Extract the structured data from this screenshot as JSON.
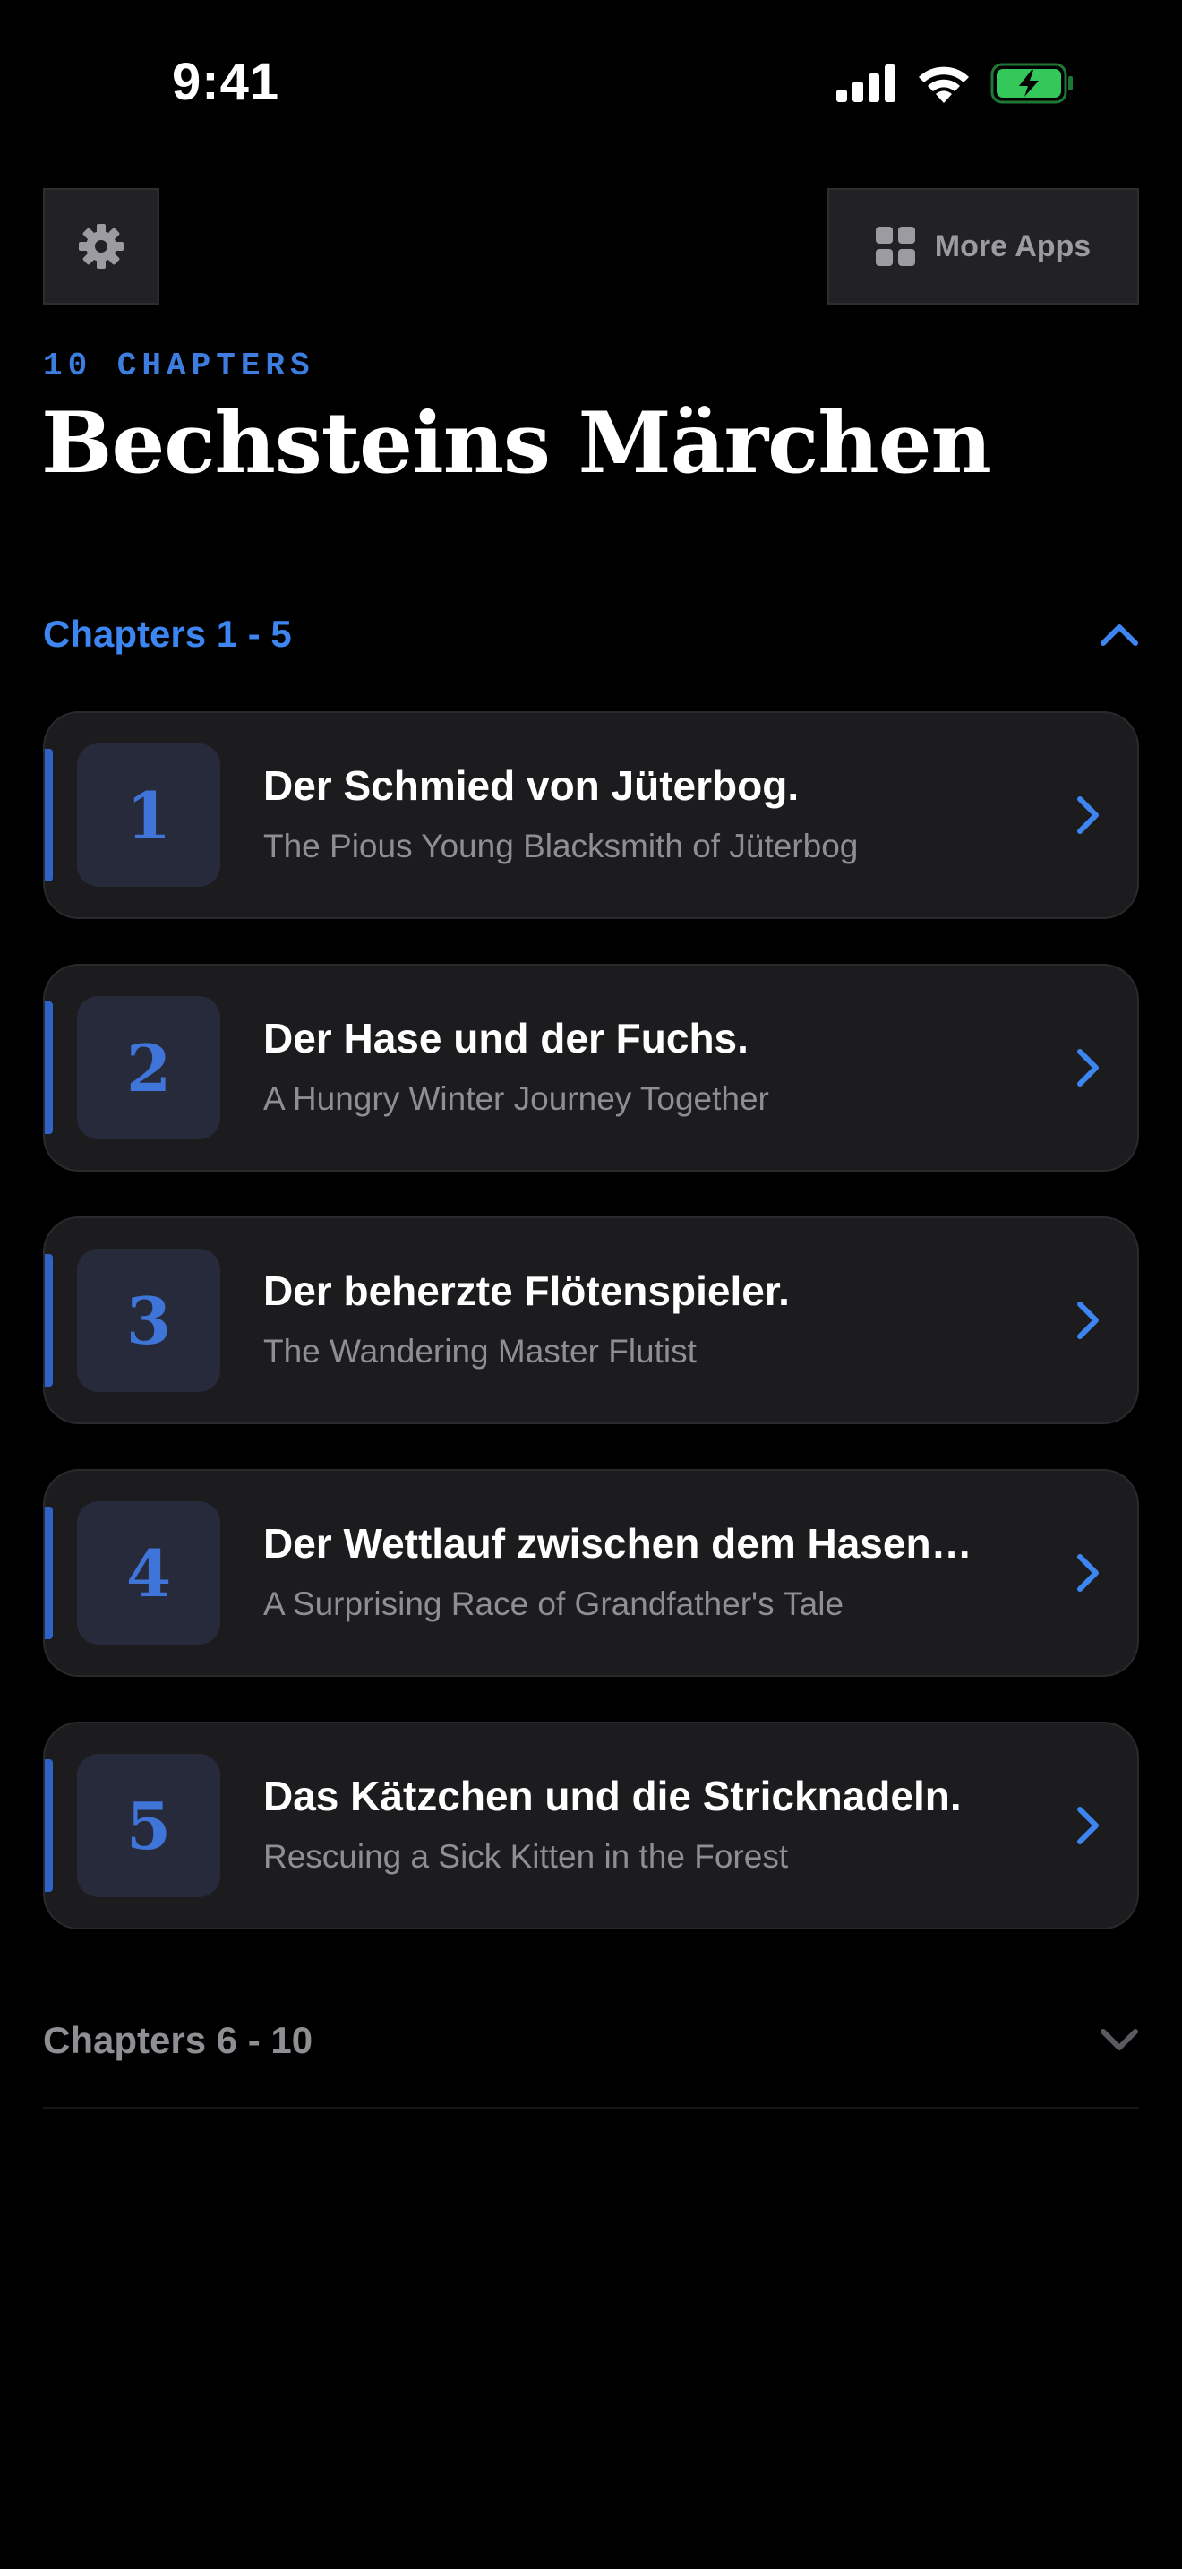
{
  "status_bar": {
    "time": "9:41"
  },
  "header": {
    "settings_icon": "gear-icon",
    "more_apps_label": "More Apps",
    "more_apps_icon": "grid-icon",
    "chapter_count": "10 CHAPTERS",
    "title": "Bechsteins Märchen"
  },
  "sections": [
    {
      "label": "Chapters 1 - 5",
      "expanded": true,
      "icon": "chevron-up-icon"
    },
    {
      "label": "Chapters 6 - 10",
      "expanded": false,
      "icon": "chevron-down-icon"
    }
  ],
  "chapters": [
    {
      "number": "1",
      "title": "Der Schmied von Jüterbog.",
      "subtitle": "The Pious Young Blacksmith of Jüterbog"
    },
    {
      "number": "2",
      "title": "Der Hase und der Fuchs.",
      "subtitle": "A Hungry Winter Journey Together"
    },
    {
      "number": "3",
      "title": "Der beherzte Flötenspieler.",
      "subtitle": "The Wandering Master Flutist"
    },
    {
      "number": "4",
      "title": "Der Wettlauf zwischen dem Hasen…",
      "subtitle": "A Surprising Race of Grandfather's Tale"
    },
    {
      "number": "5",
      "title": "Das Kätzchen und die Stricknadeln.",
      "subtitle": "Rescuing a Sick Kitten in the Forest"
    }
  ],
  "colors": {
    "accent": "#3d85f0",
    "background": "#000000",
    "card": "#1c1c1e",
    "muted": "#8e8e93",
    "battery": "#34c759"
  }
}
